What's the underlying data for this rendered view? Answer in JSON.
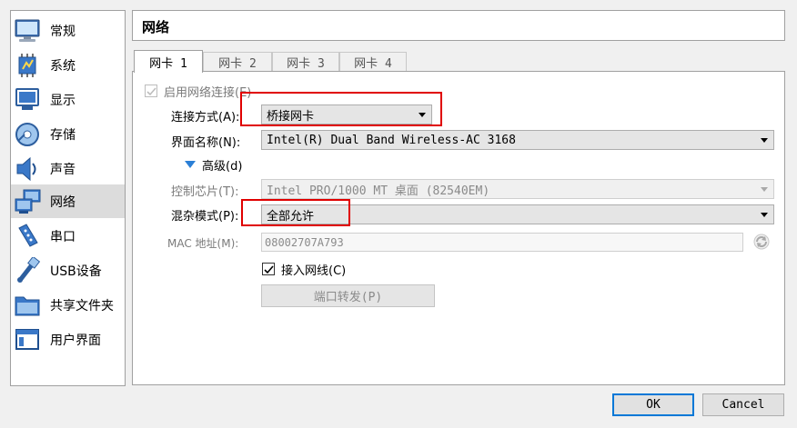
{
  "sidebar": {
    "items": [
      {
        "label": "常规",
        "icon": "monitor-icon"
      },
      {
        "label": "系统",
        "icon": "chip-icon"
      },
      {
        "label": "显示",
        "icon": "display-icon"
      },
      {
        "label": "存储",
        "icon": "disk-icon"
      },
      {
        "label": "声音",
        "icon": "speaker-icon"
      },
      {
        "label": "网络",
        "icon": "network-icon"
      },
      {
        "label": "串口",
        "icon": "serial-port-icon"
      },
      {
        "label": "USB设备",
        "icon": "usb-icon"
      },
      {
        "label": "共享文件夹",
        "icon": "folder-icon"
      },
      {
        "label": "用户界面",
        "icon": "window-icon"
      }
    ],
    "selected_index": 5
  },
  "page": {
    "title": "网络"
  },
  "tabs": [
    "网卡 1",
    "网卡 2",
    "网卡 3",
    "网卡 4"
  ],
  "form": {
    "enable_label": "启用网络连接(E)",
    "attached_label": "连接方式(A):",
    "attached_value": "桥接网卡",
    "name_label": "界面名称(N):",
    "name_value": "Intel(R) Dual Band Wireless-AC 3168",
    "advanced_label": "高级(d)",
    "adapter_label": "控制芯片(T):",
    "adapter_value": "Intel PRO/1000 MT 桌面 (82540EM)",
    "promisc_label": "混杂模式(P):",
    "promisc_value": "全部允许",
    "mac_label": "MAC 地址(M):",
    "mac_value": "08002707A793",
    "cable_label": "接入网线(C)",
    "port_forward_label": "端口转发(P)"
  },
  "footer": {
    "ok": "OK",
    "cancel": "Cancel"
  },
  "colors": {
    "accent": "#0078d7",
    "highlight_red": "#e00000",
    "selected_bg": "#dcdcdc"
  }
}
